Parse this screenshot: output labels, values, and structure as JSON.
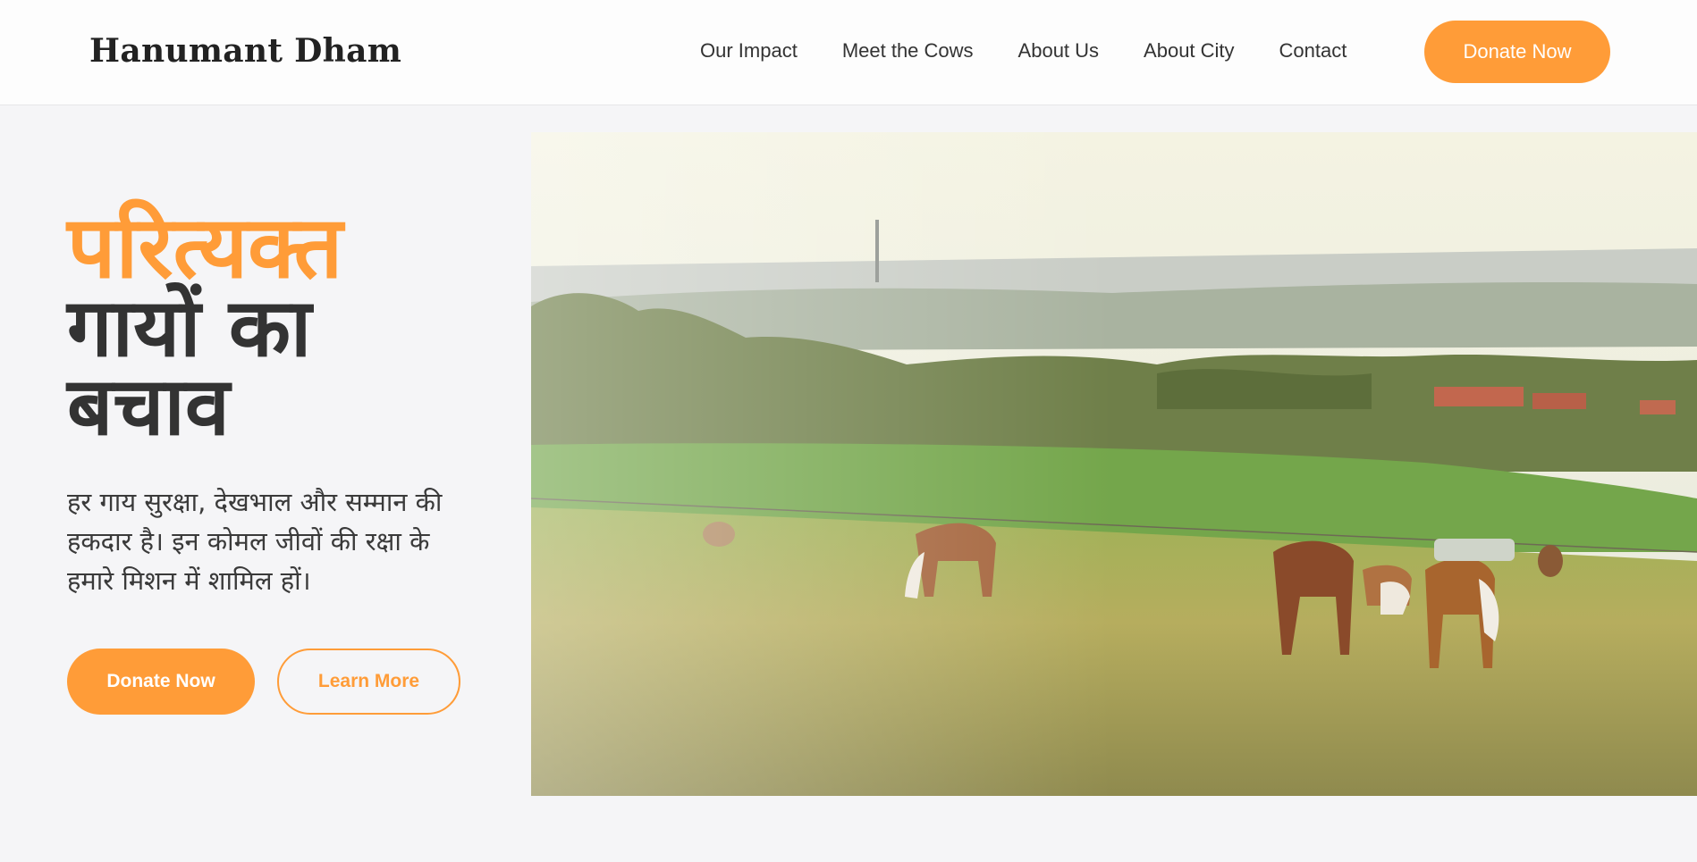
{
  "brand": "Hanumant Dham",
  "nav": {
    "items": [
      "Our Impact",
      "Meet the Cows",
      "About Us",
      "About City",
      "Contact"
    ],
    "donate_label": "Donate Now"
  },
  "hero": {
    "title_accent": "परित्यक्त",
    "title_line2": "गायों का",
    "title_line3": "बचाव",
    "subtitle": "हर गाय सुरक्षा, देखभाल और सम्मान की हकदार है। इन कोमल जीवों की रक्षा के हमारे मिशन में शामिल हों।",
    "primary_button": "Donate Now",
    "secondary_button": "Learn More"
  },
  "colors": {
    "accent": "#ff9c38",
    "text_dark": "#333333",
    "background": "#f5f5f7"
  }
}
